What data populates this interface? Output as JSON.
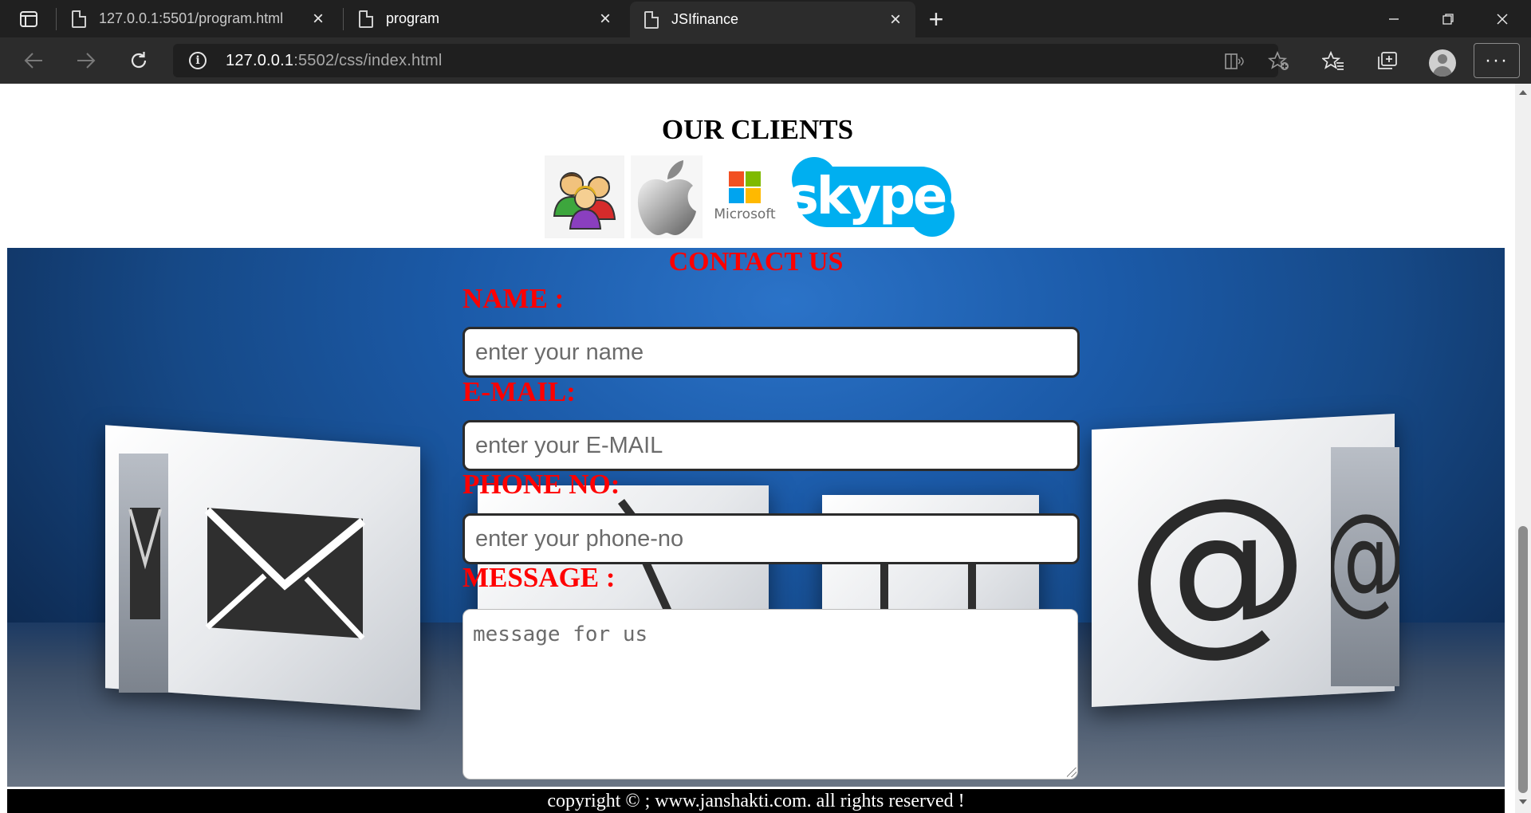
{
  "browser": {
    "tabs": [
      {
        "label": "127.0.0.1:5501/program.html",
        "active": false
      },
      {
        "label": "program",
        "active": false
      },
      {
        "label": "JSIfinance",
        "active": true
      }
    ],
    "url_host": "127.0.0.1",
    "url_rest": ":5502/css/index.html",
    "new_tab_glyph": "+",
    "close_glyph": "×",
    "more_glyph": "···",
    "icons": [
      "tab-actions-icon",
      "back-icon",
      "forward-icon",
      "refresh-icon",
      "info-icon",
      "immersive-reader-icon",
      "add-favorite-icon",
      "favorites-icon",
      "collections-icon",
      "profile-icon",
      "more-icon",
      "minimize-icon",
      "restore-icon",
      "window-close-icon"
    ]
  },
  "page": {
    "clients_title": "OUR CLIENTS",
    "clients": [
      {
        "name": "people-logo"
      },
      {
        "name": "apple-logo"
      },
      {
        "name": "microsoft-logo",
        "text": "Microsoft"
      },
      {
        "name": "skype-logo",
        "text": "skype"
      }
    ],
    "contact": {
      "title": "CONTACT US",
      "name_label": "NAME :",
      "name_placeholder": "enter your name",
      "email_label": "E-MAIL:",
      "email_placeholder": "enter your E-MAIL",
      "phone_label": "PHONE NO:",
      "phone_placeholder": "enter your phone-no",
      "message_label": "MESSAGE :",
      "message_placeholder": "message for us"
    },
    "footer": "copyright © ; www.janshakti.com. all rights reserved !"
  },
  "colors": {
    "accent_red": "#ff0000",
    "chrome_dark": "#202020",
    "toolbar": "#2c2c2c",
    "skype_blue": "#00aff0"
  }
}
